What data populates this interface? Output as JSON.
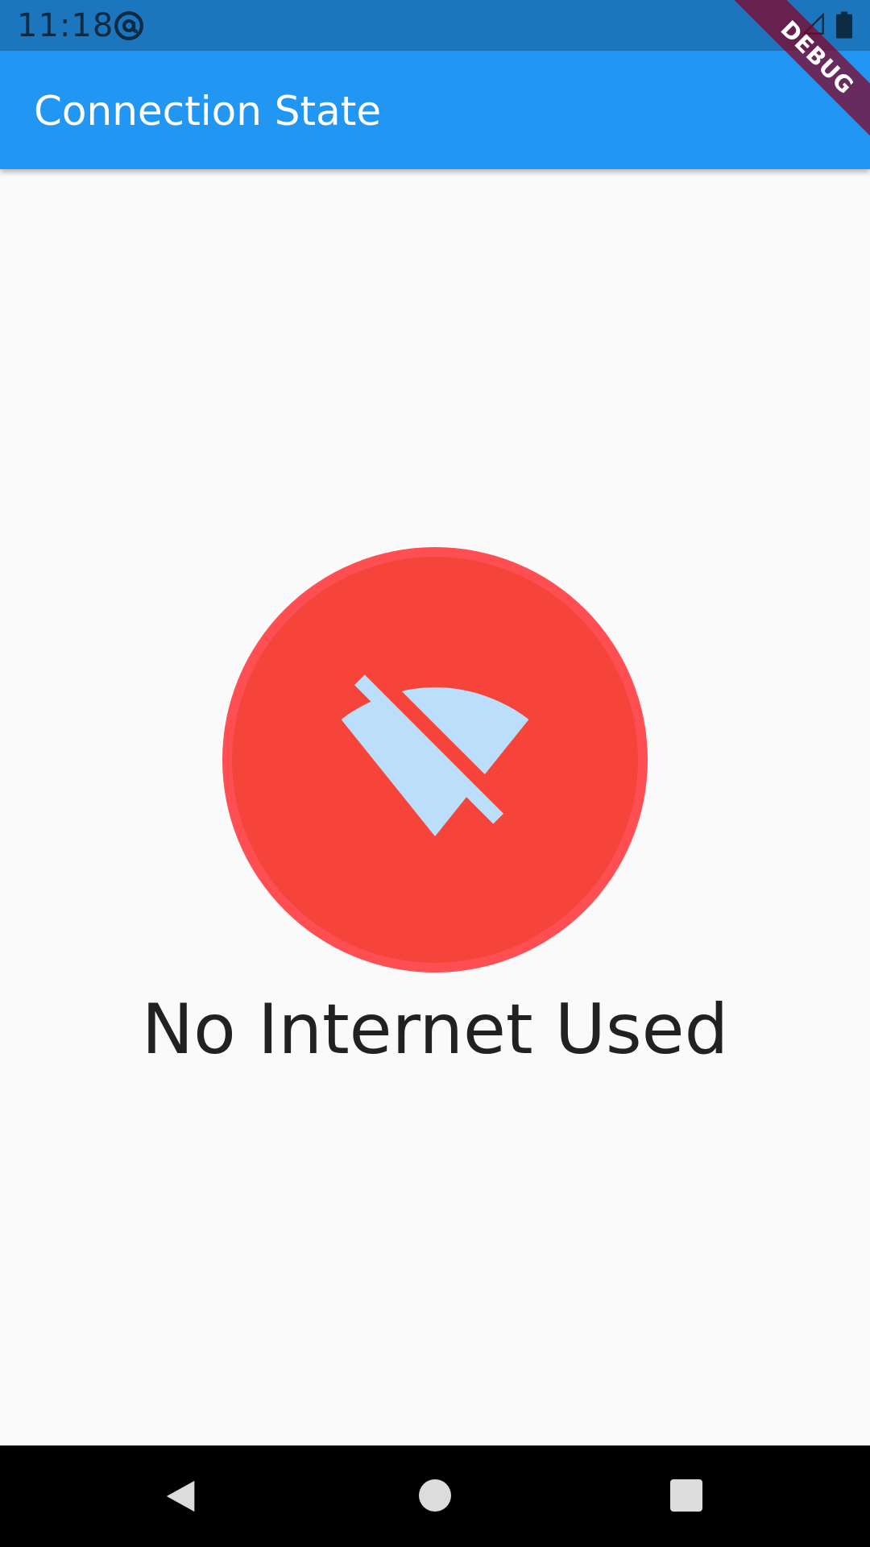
{
  "status_bar": {
    "time": "11:18",
    "icons": [
      "at-sign-icon",
      "signal-icon",
      "battery-icon"
    ],
    "background": "#1c76bd"
  },
  "app_bar": {
    "title": "Connection State",
    "background": "#2196f3"
  },
  "debug_banner": {
    "label": "DEBUG"
  },
  "connection": {
    "icon": "wifi-off-icon",
    "message": "No Internet Used",
    "circle_color": "#f6443b",
    "icon_color": "#bbdefb"
  },
  "nav_bar": {
    "icons": [
      "back-icon",
      "home-icon",
      "recent-apps-icon"
    ]
  }
}
